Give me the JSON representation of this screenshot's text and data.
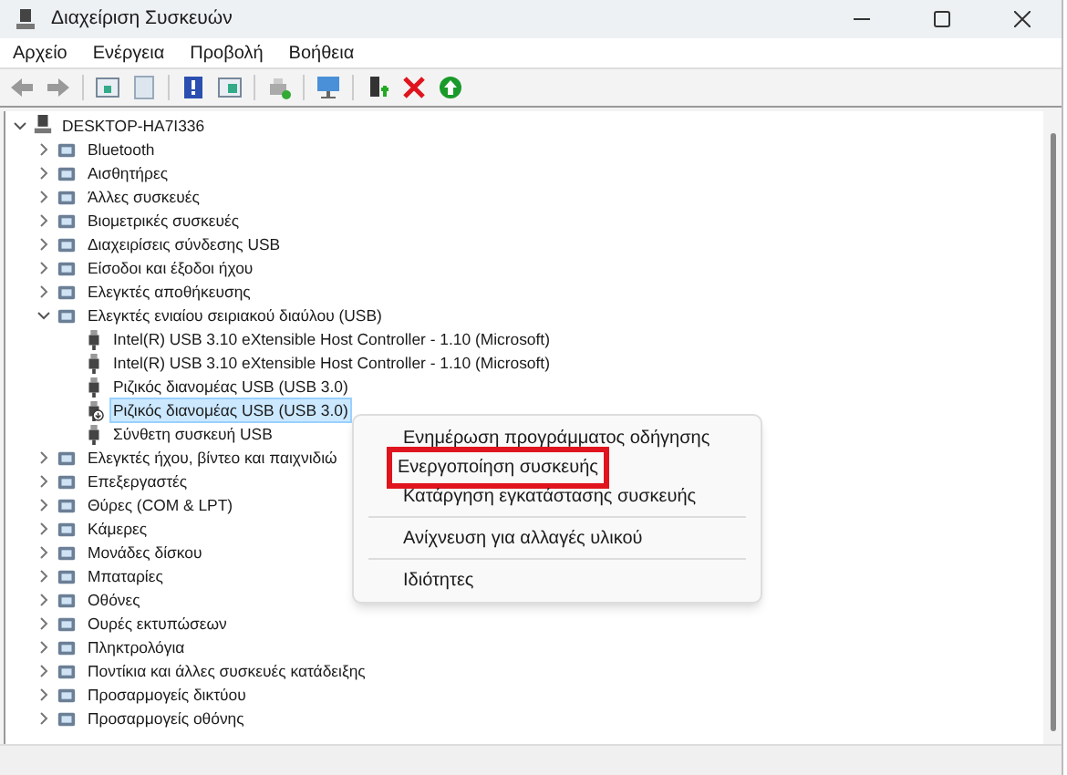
{
  "window": {
    "title": "Διαχείριση Συσκευών"
  },
  "menu": [
    "Αρχείο",
    "Ενέργεια",
    "Προβολή",
    "Βοήθεια"
  ],
  "tree": {
    "label": "DESKTOP-HA7I336",
    "expanded": true,
    "children": [
      {
        "label": "Bluetooth",
        "expanded": false,
        "selected": false
      },
      {
        "label": "Αισθητήρες",
        "expanded": false,
        "selected": false
      },
      {
        "label": "Άλλες συσκευές",
        "expanded": false,
        "selected": false
      },
      {
        "label": "Βιομετρικές συσκευές",
        "expanded": false,
        "selected": false
      },
      {
        "label": "Διαχειρίσεις σύνδεσης USB",
        "expanded": false,
        "selected": false
      },
      {
        "label": "Είσοδοι και έξοδοι ήχου",
        "expanded": false,
        "selected": false
      },
      {
        "label": "Ελεγκτές αποθήκευσης",
        "expanded": false,
        "selected": false
      },
      {
        "label": "Ελεγκτές ενιαίου σειριακού διαύλου (USB)",
        "expanded": true,
        "selected": false,
        "children": [
          {
            "label": "Intel(R) USB 3.10 eXtensible Host Controller - 1.10 (Microsoft)",
            "selected": false,
            "disabled": false
          },
          {
            "label": "Intel(R) USB 3.10 eXtensible Host Controller - 1.10 (Microsoft)",
            "selected": false,
            "disabled": false
          },
          {
            "label": "Ριζικός διανομέας USB (USB 3.0)",
            "selected": false,
            "disabled": false
          },
          {
            "label": "Ριζικός διανομέας USB (USB 3.0)",
            "selected": true,
            "disabled": true
          },
          {
            "label": "Σύνθετη συσκευή USB",
            "selected": false,
            "disabled": false
          }
        ]
      },
      {
        "label": "Ελεγκτές ήχου, βίντεο και παιχνιδιώ",
        "expanded": false,
        "selected": false
      },
      {
        "label": "Επεξεργαστές",
        "expanded": false,
        "selected": false
      },
      {
        "label": "Θύρες (COM & LPT)",
        "expanded": false,
        "selected": false
      },
      {
        "label": "Κάμερες",
        "expanded": false,
        "selected": false
      },
      {
        "label": "Μονάδες δίσκου",
        "expanded": false,
        "selected": false
      },
      {
        "label": "Μπαταρίες",
        "expanded": false,
        "selected": false
      },
      {
        "label": "Οθόνες",
        "expanded": false,
        "selected": false
      },
      {
        "label": "Ουρές εκτυπώσεων",
        "expanded": false,
        "selected": false
      },
      {
        "label": "Πληκτρολόγια",
        "expanded": false,
        "selected": false
      },
      {
        "label": "Ποντίκια και άλλες συσκευές κατάδειξης",
        "expanded": false,
        "selected": false
      },
      {
        "label": "Προσαρμογείς δικτύου",
        "expanded": false,
        "selected": false
      },
      {
        "label": "Προσαρμογείς οθόνης",
        "expanded": false,
        "selected": false
      }
    ]
  },
  "context_menu": [
    {
      "label": "Ενημέρωση προγράμματος οδήγησης",
      "highlighted": false,
      "separator_after": false
    },
    {
      "label": "Ενεργοποίηση συσκευής",
      "highlighted": true,
      "separator_after": false
    },
    {
      "label": "Κατάργηση εγκατάστασης συσκευής",
      "highlighted": false,
      "separator_after": true
    },
    {
      "label": "Ανίχνευση για αλλαγές υλικού",
      "highlighted": false,
      "separator_after": true
    },
    {
      "label": "Ιδιότητες",
      "highlighted": false,
      "separator_after": false
    }
  ]
}
